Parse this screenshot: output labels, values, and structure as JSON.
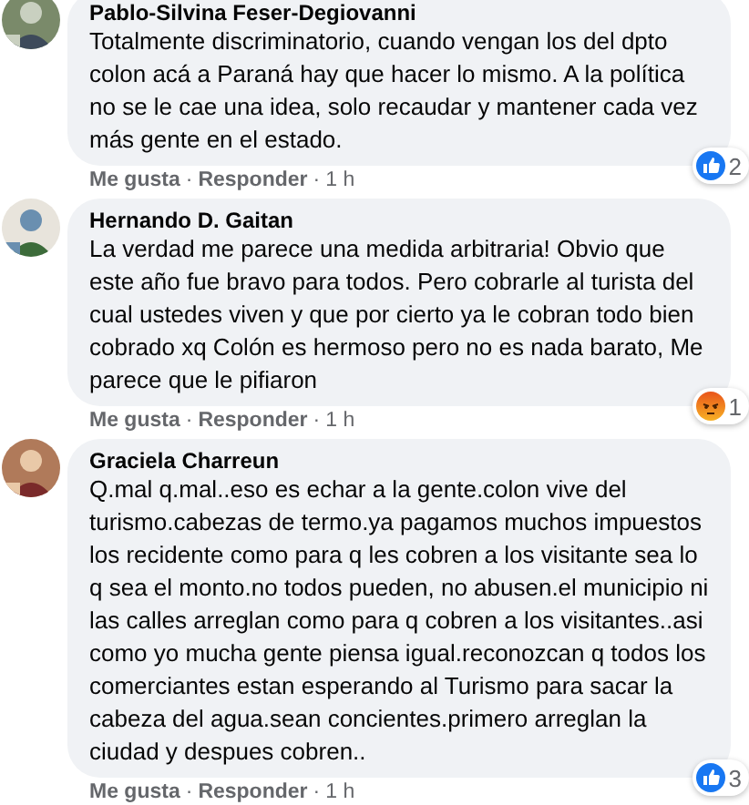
{
  "comments": [
    {
      "author": "Pablo-Silvina Feser-Degiovanni",
      "text": "Totalmente discriminatorio, cuando vengan los del dpto colon acá a Paraná hay que hacer lo mismo. A la política no se le cae una idea, solo recaudar y mantener cada vez más gente en el estado.",
      "reaction": {
        "kind": "like",
        "count": "2"
      },
      "actions": [
        {
          "kind": "link",
          "text": "Me gusta"
        },
        {
          "kind": "separator",
          "text": "·"
        },
        {
          "kind": "link",
          "text": "Responder"
        },
        {
          "kind": "separator",
          "text": "·"
        },
        {
          "kind": "time",
          "text": "1 h"
        }
      ]
    },
    {
      "author": "Hernando D. Gaitan",
      "text": "La verdad me parece una medida arbitraria! Obvio que este año fue bravo para todos. Pero cobrarle al turista del cual ustedes viven y que por cierto ya le cobran todo bien cobrado xq Colón es hermoso pero no es nada barato, Me parece que le pifiaron",
      "reaction": {
        "kind": "angry",
        "count": "1"
      },
      "actions": [
        {
          "kind": "link",
          "text": "Me gusta"
        },
        {
          "kind": "separator",
          "text": "·"
        },
        {
          "kind": "link",
          "text": "Responder"
        },
        {
          "kind": "separator",
          "text": "·"
        },
        {
          "kind": "time",
          "text": "1 h"
        }
      ]
    },
    {
      "author": "Graciela Charreun",
      "text": "Q.mal q.mal..eso es echar a la gente.colon vive del turismo.cabezas de termo.ya pagamos muchos impuestos los recidente como para q les cobren a los visitante sea lo q sea el monto.no todos pueden, no abusen.el municipio ni las calles arreglan como para q cobren a los visitantes..asi como yo mucha gente piensa igual.reconozcan q todos los comerciantes estan esperando al Turismo para sacar la cabeza del agua.sean concientes.primero arreglan la ciudad y despues cobren..",
      "reaction": {
        "kind": "like",
        "count": "3"
      },
      "actions": [
        {
          "kind": "link",
          "text": "Me gusta"
        },
        {
          "kind": "separator",
          "text": "·"
        },
        {
          "kind": "link",
          "text": "Responder"
        },
        {
          "kind": "separator",
          "text": "·"
        },
        {
          "kind": "time",
          "text": "1 h"
        }
      ]
    }
  ]
}
